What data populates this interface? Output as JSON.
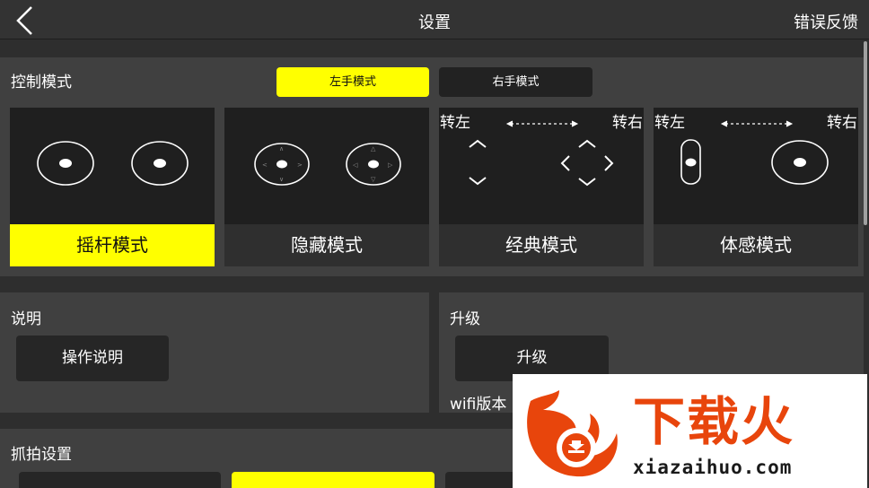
{
  "header": {
    "title": "设置",
    "feedback_label": "错误反馈"
  },
  "control_mode": {
    "label": "控制模式",
    "left_hand_label": "左手模式",
    "right_hand_label": "右手模式",
    "selected_hand": "left",
    "modes": [
      {
        "label": "摇杆模式",
        "selected": true
      },
      {
        "label": "隐藏模式",
        "selected": false
      },
      {
        "label": "经典模式",
        "selected": false,
        "turn_left": "转左",
        "turn_right": "转右"
      },
      {
        "label": "体感模式",
        "selected": false,
        "turn_left": "转左",
        "turn_right": "转右"
      }
    ]
  },
  "instructions": {
    "label": "说明",
    "button_label": "操作说明"
  },
  "upgrade": {
    "label": "升级",
    "button_label": "升级",
    "wifi_version_label": "wifi版本",
    "wifi_version_value": "null"
  },
  "capture": {
    "label": "抓拍设置"
  },
  "watermark": {
    "title": "下载火",
    "domain": "xiazaihuo.com"
  },
  "colors": {
    "accent": "#ffff00",
    "background": "#2e2e2e",
    "panel": "#404040",
    "watermark_orange": "#e8450c"
  },
  "icons": [
    "back-arrow-icon",
    "joystick-icon",
    "arrow-icon",
    "flame-logo-icon"
  ]
}
